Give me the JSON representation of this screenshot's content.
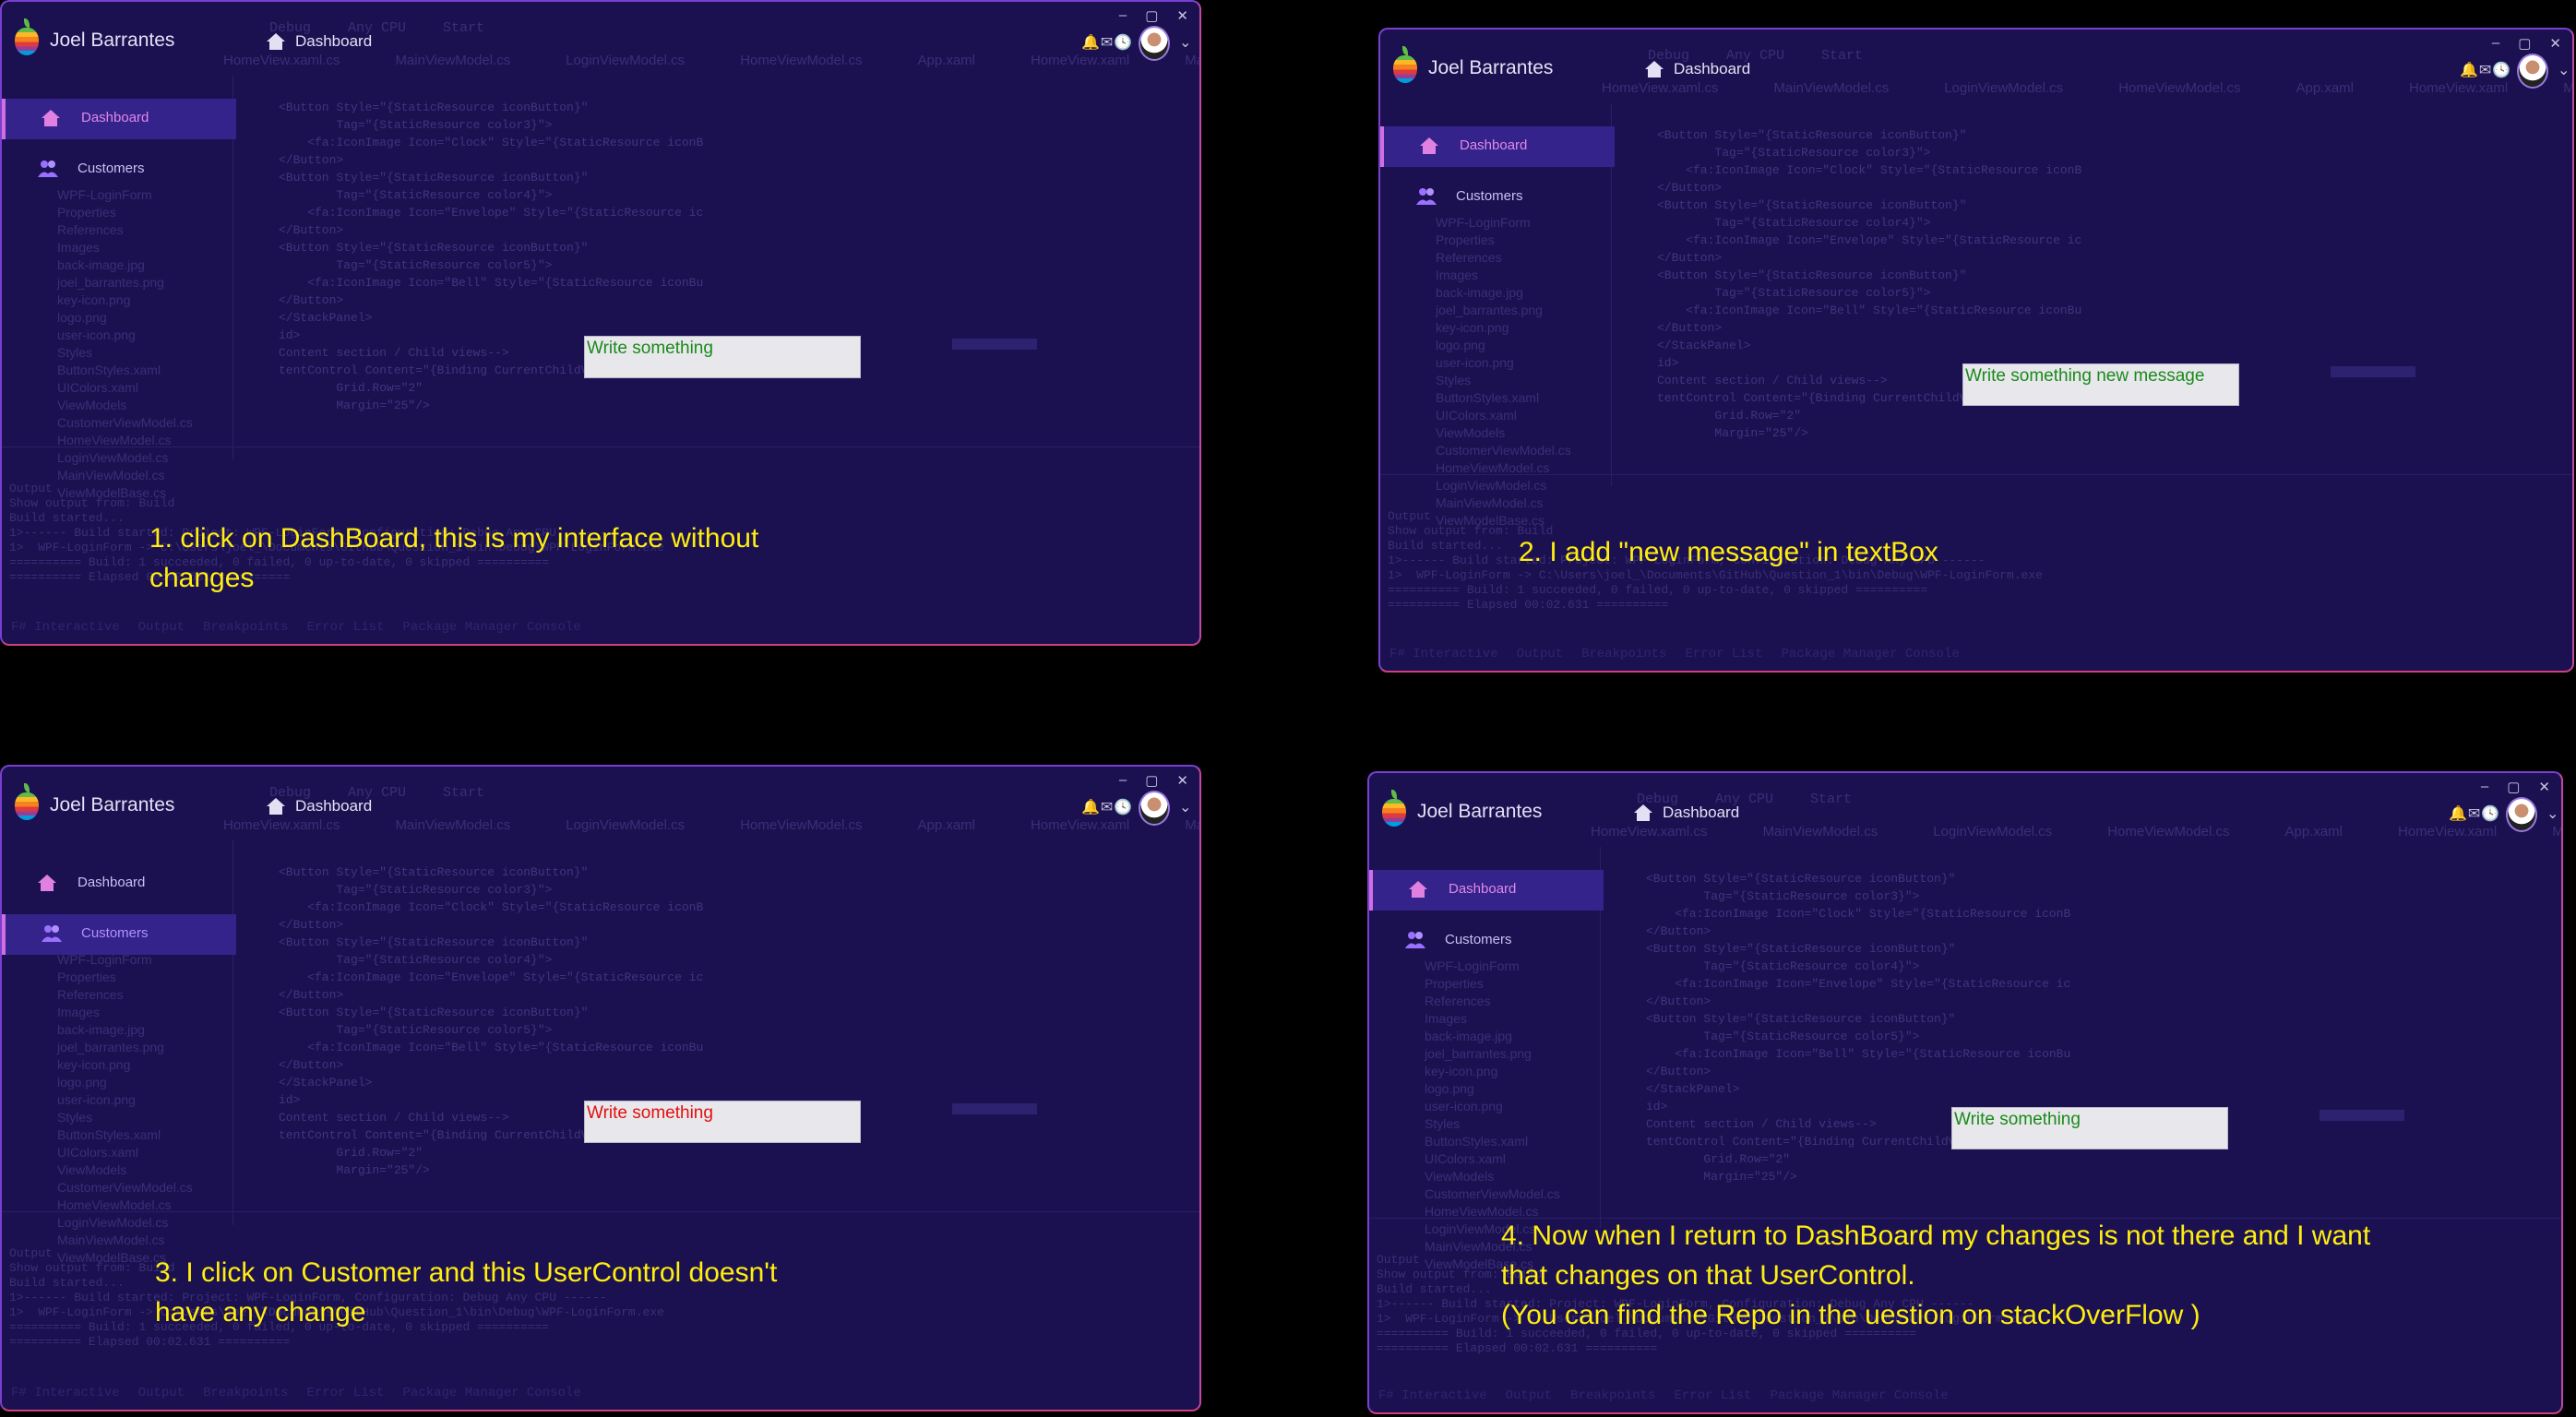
{
  "header": {
    "user_name": "Joel Barrantes",
    "current_view": "Dashboard",
    "logo_icon": "rainbow-apple-logo",
    "status_icons": "🔔✉🕓"
  },
  "sidebar": {
    "items": [
      {
        "label": "Dashboard",
        "icon": "home-icon"
      },
      {
        "label": "Customers",
        "icon": "users-icon"
      }
    ]
  },
  "ide_background": {
    "toolbar": [
      "Debug",
      "Any CPU",
      "Start"
    ],
    "tabs": [
      "HomeView.xaml.cs",
      "MainViewModel.cs",
      "LoginViewModel.cs",
      "HomeViewModel.cs",
      "App.xaml",
      "HomeView.xaml",
      "MainView.xaml"
    ],
    "tree": [
      "WPF-LoginForm",
      "Properties",
      "References",
      "Images",
      "back-image.jpg",
      "joel_barrantes.png",
      "key-icon.png",
      "logo.png",
      "user-icon.png",
      "Styles",
      "ButtonStyles.xaml",
      "UIColors.xaml",
      "ViewModels",
      "CustomerViewModel.cs",
      "HomeViewModel.cs",
      "LoginViewModel.cs",
      "MainViewModel.cs",
      "ViewModelBase.cs"
    ],
    "code": [
      "<Button Style=\"{StaticResource iconButton}\"",
      "        Tag=\"{StaticResource color3}\">",
      "    <fa:IconImage Icon=\"Clock\" Style=\"{StaticResource iconB",
      "</Button>",
      "",
      "<Button Style=\"{StaticResource iconButton}\"",
      "        Tag=\"{StaticResource color4}\">",
      "    <fa:IconImage Icon=\"Envelope\" Style=\"{StaticResource ic",
      "</Button>",
      "",
      "<Button Style=\"{StaticResource iconButton}\"",
      "        Tag=\"{StaticResource color5}\">",
      "    <fa:IconImage Icon=\"Bell\" Style=\"{StaticResource iconBu",
      "</Button>",
      "",
      "</StackPanel>",
      "id>",
      "",
      "Content section / Child views-->",
      "tentControl Content=\"{Binding CurrentChildView}\"",
      "        Grid.Row=\"2\"",
      "        Margin=\"25\"/>"
    ],
    "output": [
      "Output",
      "Show output from: Build",
      "Build started...",
      "1>------ Build started: Project: WPF-LoginForm, Configuration: Debug Any CPU ------",
      "1>  WPF-LoginForm -> C:\\Users\\joel_\\Documents\\GitHub\\Question_1\\bin\\Debug\\WPF-LoginForm.exe",
      "========== Build: 1 succeeded, 0 failed, 0 up-to-date, 0 skipped ==========",
      "========== Elapsed 00:02.631 =========="
    ],
    "bottom_tabs": [
      "F# Interactive",
      "Output",
      "Breakpoints",
      "Error List",
      "Package Manager Console"
    ]
  },
  "panels": [
    {
      "selected": "Dashboard",
      "textbox_value": "Write something",
      "text_color": "#1a8a1a",
      "caption": [
        "1. click on DashBoard, this is my interface without",
        "changes"
      ]
    },
    {
      "selected": "Dashboard",
      "textbox_value": "Write something new message",
      "text_color": "#1a8a1a",
      "caption": [
        "2. I add \"new message\" in textBox"
      ]
    },
    {
      "selected": "Customers",
      "textbox_value": "Write something",
      "text_color": "#e01010",
      "caption": [
        "3. I click on Customer and this UserControl doesn't",
        "have any change"
      ]
    },
    {
      "selected": "Dashboard",
      "textbox_value": "Write something",
      "text_color": "#1a8a1a",
      "caption": [
        "4. Now when I return to DashBoard my changes is not there and I want",
        "that changes on that UserControl.",
        "(You can find the Repo in the uestion on stackOverFlow )"
      ]
    }
  ],
  "colors": {
    "background": "#1b1150",
    "caption": "#ffee10",
    "selected_accent": "#d070e0"
  }
}
